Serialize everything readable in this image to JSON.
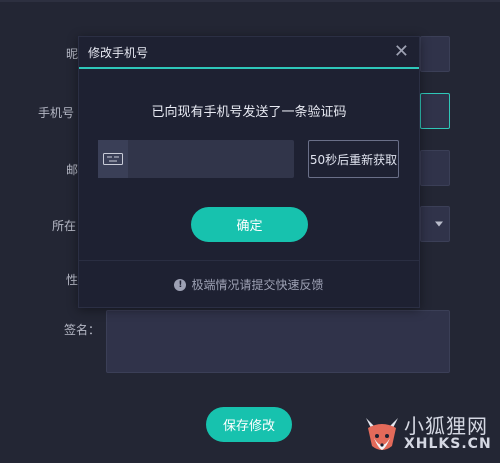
{
  "form": {
    "nickname_label": "昵",
    "phone_label": "手机号",
    "email_label": "邮",
    "location_label": "所在",
    "gender_label": "性",
    "signature_label": "签名：",
    "save_label": "保存修改"
  },
  "modal": {
    "title": "修改手机号",
    "message": "已向现有手机号发送了一条验证码",
    "code_placeholder": "",
    "resend_label": "50秒后重新获取",
    "confirm_label": "确定",
    "feedback_label": "极端情况请提交快速反馈",
    "warn_glyph": "!",
    "close_glyph": "✕"
  },
  "watermark": {
    "line1": "小狐狸网",
    "line2": "XHLKS.CN"
  },
  "colors": {
    "background": "#232634",
    "accent": "#17c2ae",
    "modal_bg": "#1e2132"
  }
}
